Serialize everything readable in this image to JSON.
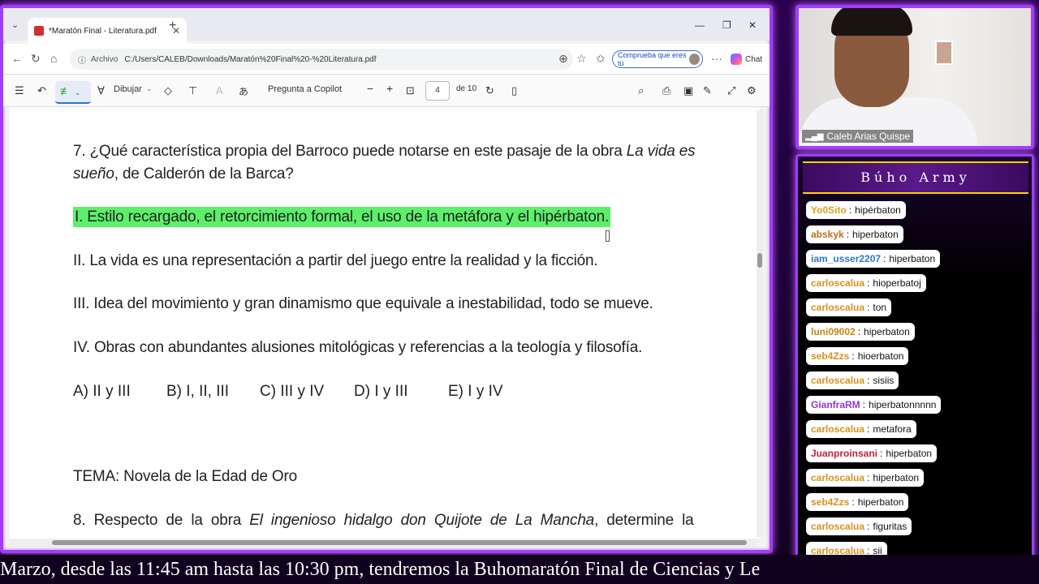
{
  "browser": {
    "tab_title": "*Maratón Final - Literatura.pdf",
    "tab_close": "✕",
    "new_tab": "+",
    "tab_dropdown": "⌄",
    "window_minimize": "—",
    "window_restore": "❐",
    "window_close": "✕",
    "site_label": "Archivo",
    "url": "C:/Users/CALEB/Downloads/Maratón%20Final%20-%20Literatura.pdf",
    "verify_label": "Comprueba que eres tú",
    "chat_label": "Chat",
    "more": "···"
  },
  "pdf_toolbar": {
    "draw_label": "Dibujar",
    "copilot_label": "Pregunta a Copilot",
    "page_current": "4",
    "page_total": "de 10",
    "zoom_out": "−",
    "zoom_in": "+"
  },
  "document": {
    "q7_line1_prefix": "7. ¿Qué característica propia del Barroco puede notarse en este pasaje de la obra ",
    "q7_line1_italic": "La vida es",
    "q7_line2_italic": "sueño",
    "q7_line2_rest": ", de Calderón de la Barca?",
    "option_1": "I. Estilo recargado, el retorcimiento formal, el uso de la metáfora y el hipérbaton.",
    "option_2": "II. La vida es una representación a partir del juego entre la realidad y la ficción.",
    "option_3": "III. Idea del movimiento y gran dinamismo que equivale a inestabilidad, todo se mueve.",
    "option_4": "IV. Obras con abundantes alusiones mitológicas y referencias a la teología y filosofía.",
    "answers": [
      "A) II y III",
      "B) I, II, III",
      "C) III y IV",
      "D) I y III",
      "E) I y IV"
    ],
    "tema": "TEMA: Novela de la Edad de Oro",
    "q8_prefix": "8.  Respecto  de  la  obra  ",
    "q8_italic": "El  ingenioso  hidalgo  don  Quijote  de  La  Mancha",
    "q8_rest": ",  determine  la"
  },
  "webcam": {
    "name": "Caleb Arias Quispe",
    "signal_icon": "▂▄▆"
  },
  "chat": {
    "title": "Búho Army",
    "messages": [
      {
        "user": "Yo0Sito",
        "text": "hipérbaton",
        "color": "#d8a020"
      },
      {
        "user": "abskyk",
        "text": "hiperbaton",
        "color": "#c07018"
      },
      {
        "user": "iam_usser2207",
        "text": "hiperbaton",
        "color": "#2a78c8"
      },
      {
        "user": "carloscalua",
        "text": "hioperbatoj",
        "color": "#d89020"
      },
      {
        "user": "carloscalua",
        "text": "ton",
        "color": "#d89020"
      },
      {
        "user": "luni09002",
        "text": "hiperbaton",
        "color": "#c08818"
      },
      {
        "user": "seb4Zzs",
        "text": "hioerbaton",
        "color": "#d89020"
      },
      {
        "user": "carloscalua",
        "text": "sisiis",
        "color": "#d89020"
      },
      {
        "user": "GianfraRM",
        "text": "hiperbatonnnnn",
        "color": "#8a3ad8"
      },
      {
        "user": "carloscalua",
        "text": "metafora",
        "color": "#d89020"
      },
      {
        "user": "Juanproinsani",
        "text": "hiperbaton",
        "color": "#c0203a"
      },
      {
        "user": "carloscalua",
        "text": "hiperbaton",
        "color": "#d89020"
      },
      {
        "user": "seb4Zzs",
        "text": "hiperbaton",
        "color": "#d89020"
      },
      {
        "user": "carloscalua",
        "text": "figuritas",
        "color": "#d89020"
      },
      {
        "user": "carloscalua",
        "text": "sii",
        "color": "#d89020"
      }
    ]
  },
  "ticker": {
    "text": "Marzo, desde las 11:45 am hasta las 10:30 pm, tendremos la Buhomaratón Final de Ciencias y Le"
  },
  "colors": {
    "frame_accent": "#a23cff",
    "highlight": "#5cf06a",
    "chat_header_gold": "#ffd200"
  }
}
